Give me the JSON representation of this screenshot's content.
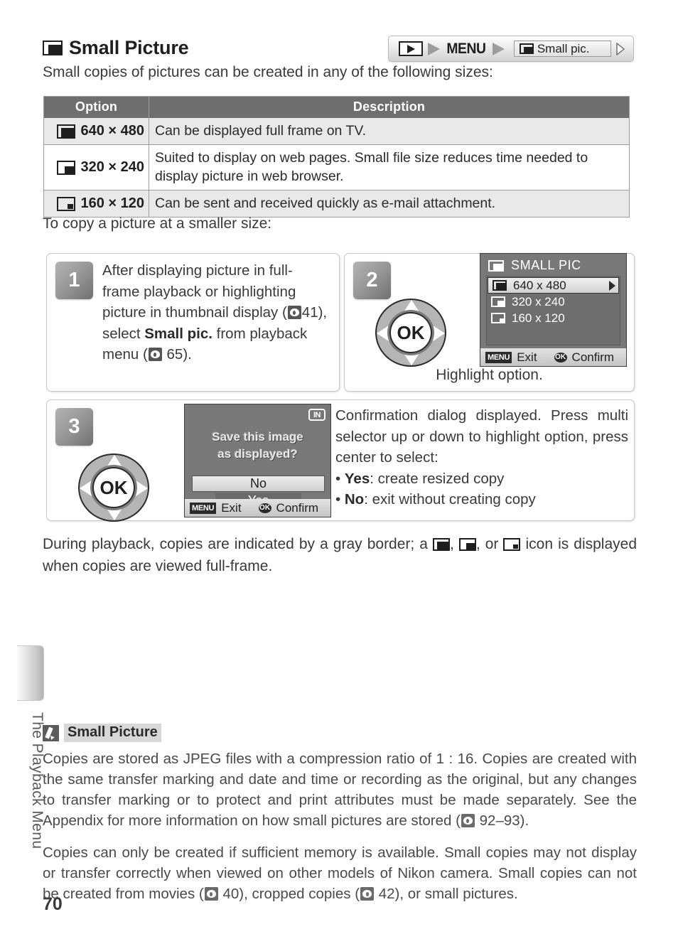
{
  "heading": {
    "title": "Small Picture",
    "icon": "small-picture-icon"
  },
  "breadcrumb": {
    "play_icon": "playback-mode-icon",
    "menu_label": "MENU",
    "field_label": "Small pic.",
    "field_icon": "small-picture-icon",
    "caret_icon": "chevron-right-icon"
  },
  "intro": "Small copies of pictures can be created in any of the following sizes:",
  "table": {
    "headers": {
      "option": "Option",
      "description": "Description"
    },
    "rows": [
      {
        "option": "640 × 480",
        "icon": "size-640-icon",
        "description": "Can be displayed full frame on TV."
      },
      {
        "option": "320 × 240",
        "icon": "size-320-icon",
        "description": "Suited to display on web pages.  Small file size reduces time needed to display picture in web browser."
      },
      {
        "option": "160 × 120",
        "icon": "size-160-icon",
        "description": "Can be sent and received quickly as e-mail attachment."
      }
    ]
  },
  "to_copy_line": "To copy a picture at a smaller size:",
  "steps": {
    "step1": {
      "number": "1",
      "text_part1": "After displaying picture in full-frame playback or highlighting picture in thumbnail display (",
      "ref1": "41",
      "text_part2": "), select ",
      "bold1": "Small pic.",
      "text_part3": " from playback menu (",
      "ref2": "65",
      "text_part4": ")."
    },
    "step2": {
      "number": "2",
      "caption": "Highlight option.",
      "selector_label": "OK",
      "lcd": {
        "title": "SMALL PIC",
        "title_icon": "small-picture-icon",
        "items": [
          {
            "label": "640 x 480",
            "icon": "size-640-icon",
            "selected": true
          },
          {
            "label": "320 x 240",
            "icon": "size-320-icon",
            "selected": false
          },
          {
            "label": "160 x 120",
            "icon": "size-160-icon",
            "selected": false
          }
        ],
        "footer": {
          "menu_key": "MENU",
          "menu_action": "Exit",
          "ok_key": "OK",
          "ok_action": "Confirm"
        }
      }
    },
    "step3": {
      "number": "3",
      "selector_label": "OK",
      "lcd": {
        "memory_badge": "IN",
        "message_line1": "Save this image",
        "message_line2": "as displayed?",
        "option_no": "No",
        "option_yes": "Yes",
        "footer": {
          "menu_key": "MENU",
          "menu_action": "Exit",
          "ok_key": "OK",
          "ok_action": "Confirm"
        }
      },
      "text_part1": "Confirmation dialog displayed.  Press multi selector up or down to highlight option, press center to select:",
      "bullet1_bold": "Yes",
      "bullet1_rest": ": create resized copy",
      "bullet2_bold": "No",
      "bullet2_rest": ": exit without creating copy"
    }
  },
  "after_note": {
    "part1": "During playback, copies are indicated by a gray border; a ",
    "part2": ", ",
    "part3": ", or ",
    "part4": " icon is displayed when copies are viewed full-frame."
  },
  "note": {
    "title": "Small Picture",
    "icon": "pencil-icon",
    "paragraph1_a": "Copies are stored as JPEG files with a compression ratio of 1 : 16.  Copies are created with the same transfer marking and date and time or recording as the original, but any changes to transfer marking or to protect and print attributes must be made separately. See the Appendix for more information on how small pictures are stored (",
    "paragraph1_ref": "92–93",
    "paragraph1_b": ").",
    "paragraph2_a": "Copies can only be created if sufficient memory is available.  Small copies may not display or transfer correctly when viewed on other models of Nikon camera.   Small copies can not be created from movies (",
    "paragraph2_ref1": "40",
    "paragraph2_b": "), cropped copies (",
    "paragraph2_ref2": "42",
    "paragraph2_c": "), or small pictures."
  },
  "chapter_label": "The Playback Menu",
  "page_number": "70"
}
